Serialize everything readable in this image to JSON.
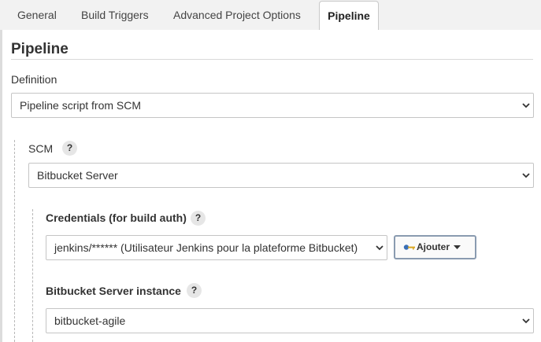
{
  "tabs": [
    "General",
    "Build Triggers",
    "Advanced Project Options",
    "Pipeline"
  ],
  "section": {
    "title": "Pipeline"
  },
  "definition": {
    "label": "Definition",
    "value": "Pipeline script from SCM"
  },
  "scm": {
    "label": "SCM",
    "help": "?",
    "value": "Bitbucket Server"
  },
  "credentials": {
    "label": "Credentials (for build auth)",
    "help": "?",
    "value": "jenkins/****** (Utilisateur Jenkins pour la plateforme Bitbucket)",
    "add_button": "Ajouter",
    "add_icon": "key-icon"
  },
  "instance": {
    "label": "Bitbucket Server instance",
    "help": "?",
    "value": "bitbucket-agile"
  },
  "colors": {
    "accent_border": "#8a9bb0",
    "key_icon": "#3a6fb5"
  }
}
